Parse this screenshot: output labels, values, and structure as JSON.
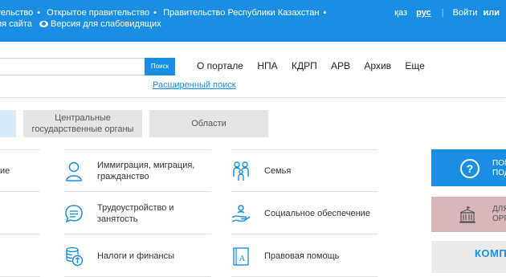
{
  "topbar": {
    "links": [
      "тельство",
      "Открытое правительство",
      "Правительство Республики Казахстан"
    ],
    "row2_text": "ия сайта",
    "low_vision": "Версия для слабовидящих",
    "lang_kz": "қаз",
    "lang_ru": "рус",
    "login": "Войти",
    "or": "или"
  },
  "header": {
    "search_placeholder": "",
    "search_button": "Поиск",
    "advanced_search": "Расширенный поиск",
    "nav": [
      "О портале",
      "НПА",
      "КДРП",
      "АРВ",
      "Архив",
      "Еще"
    ]
  },
  "categories": [
    {
      "label": "",
      "selected": true
    },
    {
      "label": "Центральные государственные органы",
      "line1": "Центральные",
      "line2": "государственные органы",
      "selected": false
    },
    {
      "label": "Области",
      "selected": false
    }
  ],
  "services": [
    {
      "label": "ие",
      "line1": "ие",
      "line2": "",
      "icon": "cropped-icon"
    },
    {
      "label": "",
      "line1": "",
      "line2": "",
      "icon": ""
    },
    {
      "label": "",
      "line1": "",
      "line2": "",
      "icon": ""
    },
    {
      "label": "Иммиграция, миграция, гражданство",
      "line1": "Иммиграция, миграция,",
      "line2": "гражданство",
      "icon": "person-icon"
    },
    {
      "label": "Трудоустройство и занятость",
      "line1": "Трудоустройство и",
      "line2": "занятость",
      "icon": "chat-list-icon"
    },
    {
      "label": "Налоги и финансы",
      "line1": "Налоги и финансы",
      "line2": "",
      "icon": "coins-icon"
    },
    {
      "label": "Семья",
      "line1": "Семья",
      "line2": "",
      "icon": "family-icon"
    },
    {
      "label": "Социальное обеспечение",
      "line1": "Социальное обеспечение",
      "line2": "",
      "icon": "hand-care-icon"
    },
    {
      "label": "Правовая помощь",
      "line1": "Правовая помощь",
      "line2": "",
      "icon": "legal-book-icon"
    }
  ],
  "side": {
    "help_icon": "?",
    "help_l1": "ПОМ",
    "help_l2": "ПОД",
    "org_l1": "ДЛЯ",
    "org_l2": "ОРГ",
    "comp": "КОМП"
  },
  "colors": {
    "accent": "#1a8ee3",
    "tab_bg": "#e4e4e4",
    "card_rose": "#d7b7b9"
  }
}
